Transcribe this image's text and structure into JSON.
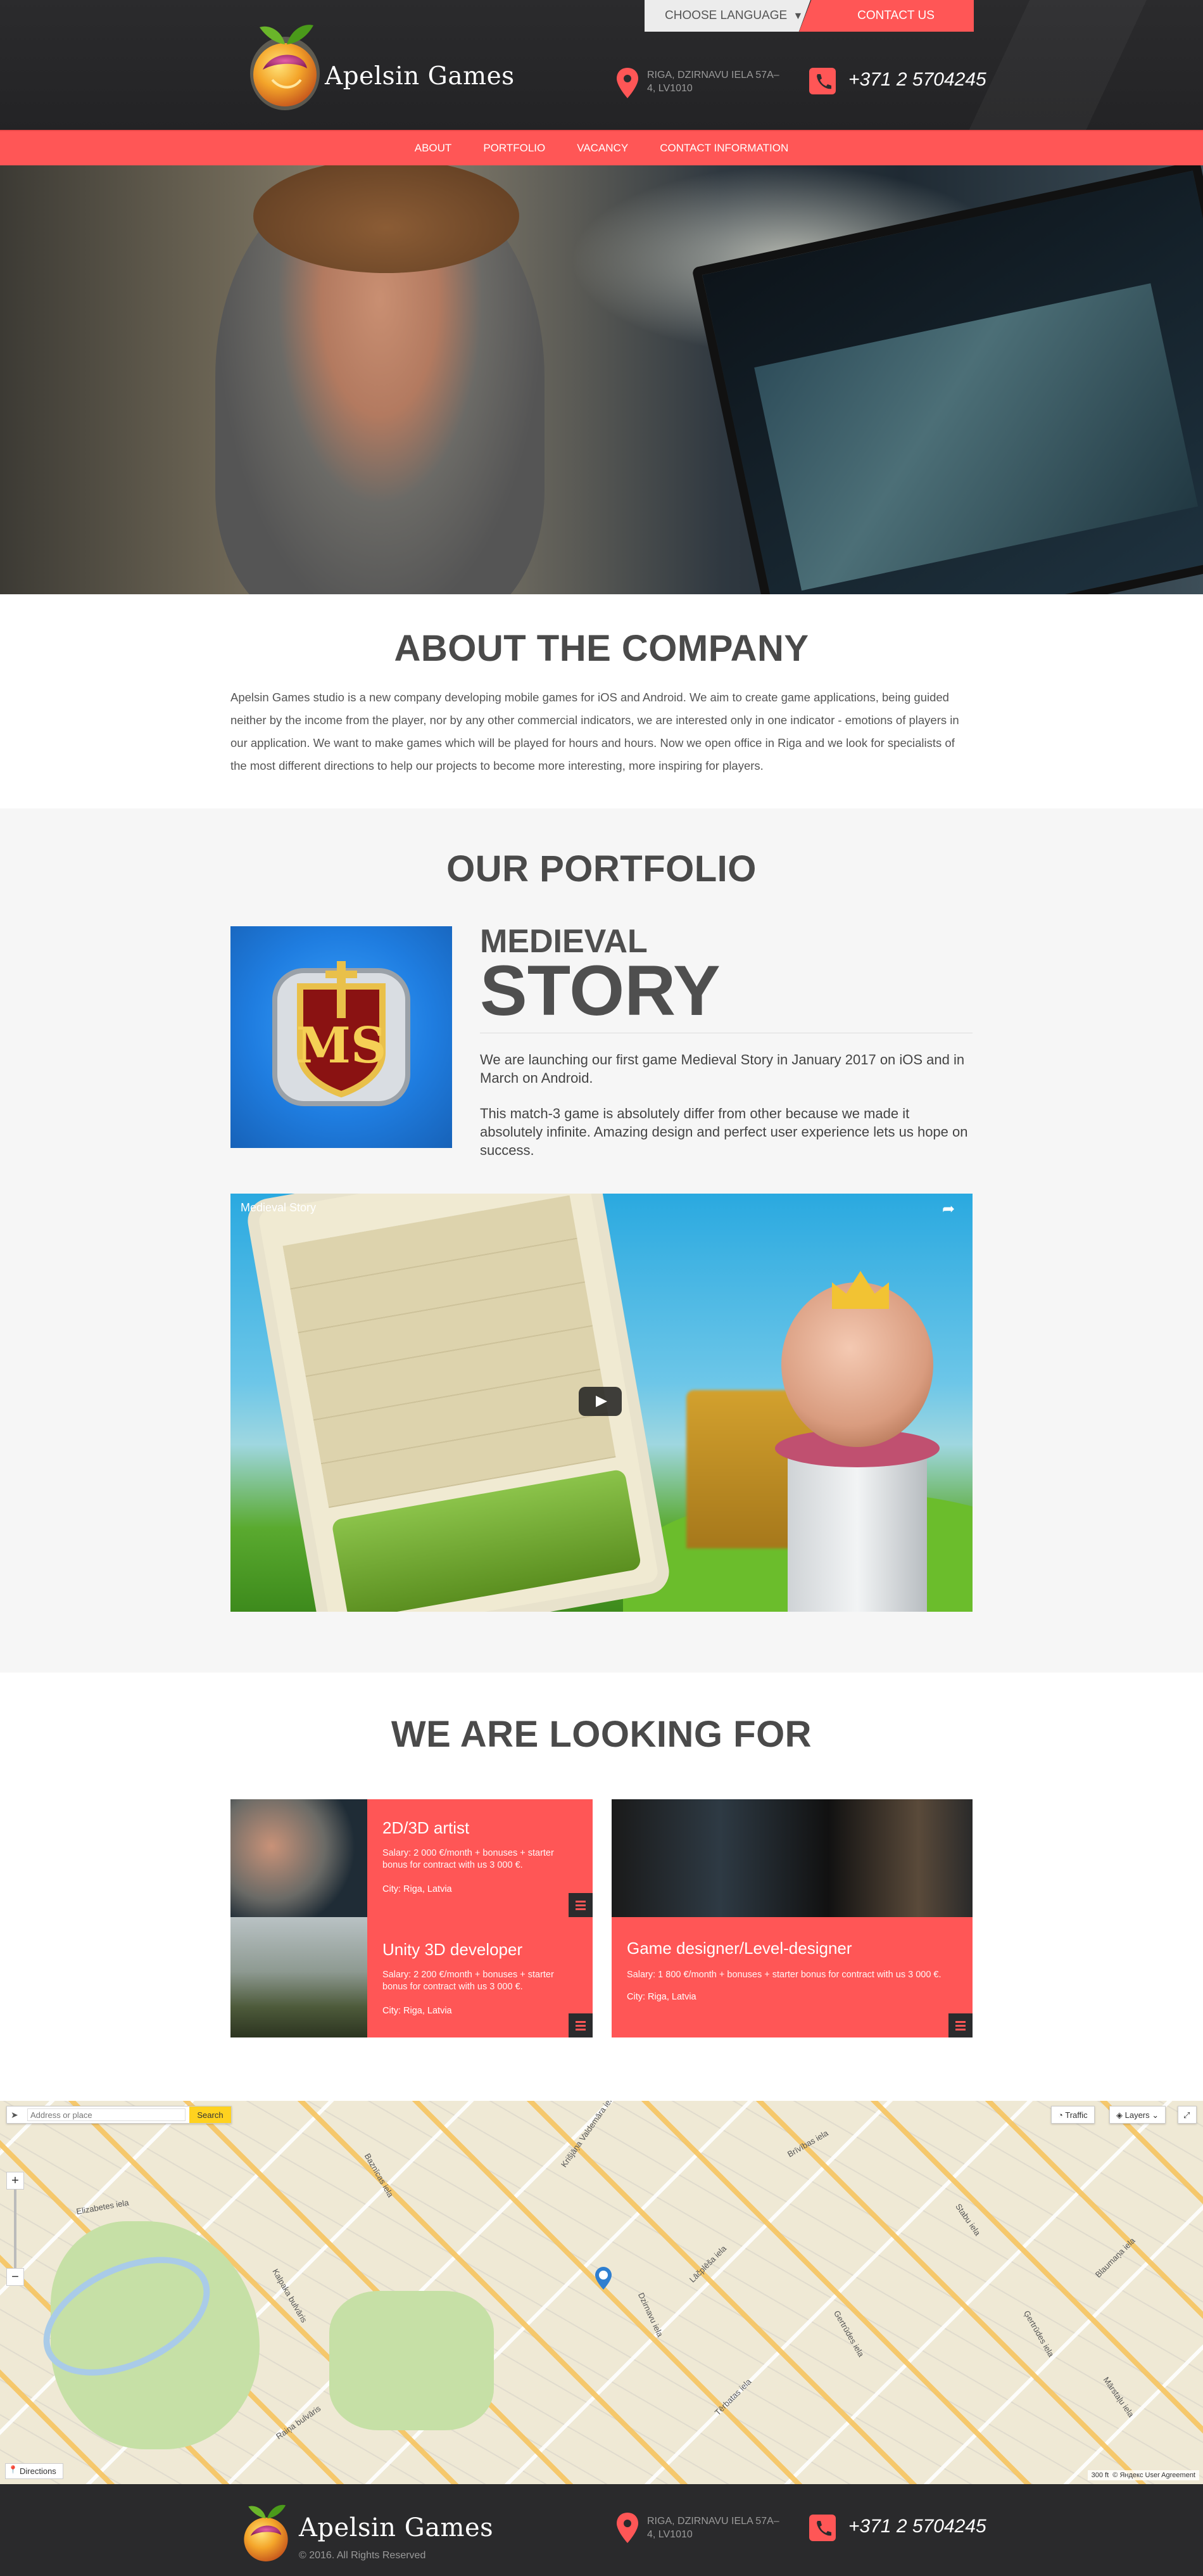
{
  "colors": {
    "accent": "#ff5656",
    "dark": "#2b2b2d",
    "text": "#4a4a4a"
  },
  "header": {
    "brand": "Apelsin Games",
    "language_label": "Choose language",
    "contact_label": "Contact us",
    "address": "Riga, Dzirnavu iela 57a–4, LV1010",
    "phone": "+371 2 5704245"
  },
  "nav": {
    "items": [
      "About",
      "Portfolio",
      "Vacancy",
      "Contact information"
    ]
  },
  "about": {
    "title": "About the company",
    "text": "Apelsin Games studio is a new company developing mobile games for iOS and Android. We aim to create game applications, being guided neither by the income from the player, nor by any other commercial indicators, we are interested only in one indicator - emotions of players in our application. We want to make games which will be played for hours and hours. Now we open office in Riga and we look for specialists of the most different directions to help our projects to become more interesting, more inspiring for players."
  },
  "portfolio": {
    "title": "Our portfolio",
    "game_title_small": "Medieval",
    "game_title_big": "Story",
    "desc_1": "We are launching our first game Medieval Story in January 2017 on iOS and in March on Android.",
    "desc_2": "This match-3 game is absolutely differ from other because we made it absolutely infinite. Amazing design and perfect user experience lets us hope on success.",
    "icon_letters": "MS",
    "video_title": "Medieval Story"
  },
  "vacancy": {
    "title": "We are looking for",
    "jobs": [
      {
        "title": "2D/3D artist",
        "salary": "Salary: 2 000 €/month + bonuses + starter bonus for contract with us 3 000 €.",
        "city": "City: Riga, Latvia"
      },
      {
        "title": "Unity 3D developer",
        "salary": "Salary: 2 200 €/month + bonuses + starter bonus for contract with us 3 000 €.",
        "city": "City: Riga, Latvia"
      },
      {
        "title": "Game designer/Level-designer",
        "salary": "Salary: 1 800 €/month + bonuses + starter bonus for contract with us 3 000 €.",
        "city": "City: Riga, Latvia"
      }
    ]
  },
  "map": {
    "search_placeholder": "Address or place",
    "search_button": "Search",
    "traffic": "Traffic",
    "layers": "Layers",
    "directions": "Directions",
    "copyright": "© Яндекс User Agreement",
    "scale": "300 ft",
    "labels": [
      "Elizabetes iela",
      "Krišjāņa Valdemāra iela",
      "Brīvības iela",
      "Kalpaka bulvāris",
      "Raiņa bulvāris",
      "Dzirnavu iela",
      "Lāčplēša iela",
      "Stabu iela",
      "Tērbatas iela",
      "Gertrūdes iela",
      "Baznīcas iela",
      "Ģertrūdes iela",
      "Blaumaņa iela",
      "Mārstaļu iela"
    ]
  },
  "footer": {
    "brand": "Apelsin Games",
    "copyright": "© 2016. All Rights Reserved",
    "address": "Riga, Dzirnavu iela 57a–4, LV1010",
    "phone": "+371 2 5704245"
  }
}
